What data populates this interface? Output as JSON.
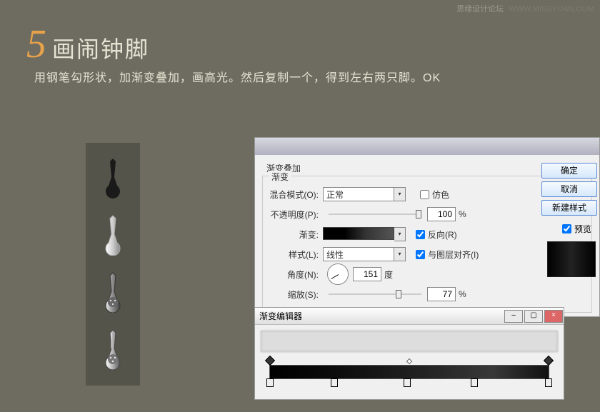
{
  "watermark": {
    "site": "思缘设计论坛",
    "url": "WWW.MISSYUAN.COM"
  },
  "header": {
    "number": "5",
    "title": "画闹钟脚"
  },
  "substep": "用钢笔勾形状，加渐变叠加，画高光。然后复制一个，得到左右两只脚。OK",
  "panel": {
    "section_title": "渐变叠加",
    "group_title": "渐变",
    "blend": {
      "label": "混合模式(O):",
      "value": "正常",
      "dither_label": "仿色"
    },
    "opacity": {
      "label": "不透明度(P):",
      "value": "100",
      "unit": "%"
    },
    "gradient": {
      "label": "渐变:",
      "reverse_label": "反向(R)"
    },
    "style": {
      "label": "样式(L):",
      "value": "线性",
      "align_label": "与图层对齐(I)"
    },
    "angle": {
      "label": "角度(N):",
      "value": "151",
      "unit": "度"
    },
    "scale": {
      "label": "缩放(S):",
      "value": "77",
      "unit": "%"
    }
  },
  "buttons": {
    "ok": "确定",
    "cancel": "取消",
    "new_style": "新建样式",
    "preview": "预览"
  },
  "editor": {
    "title": "渐变编辑器"
  }
}
